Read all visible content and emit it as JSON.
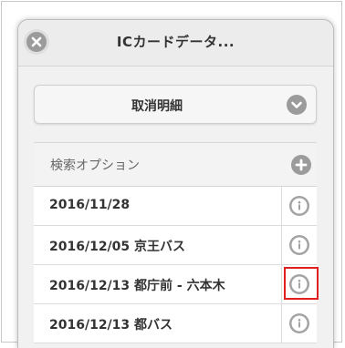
{
  "dialog": {
    "title": "ICカードデータ...",
    "close_icon": "close-icon"
  },
  "select": {
    "label": "取消明細",
    "icon": "chevron-down-icon"
  },
  "search_option": {
    "label": "検索オプション",
    "icon": "plus-icon"
  },
  "items": [
    {
      "label": "2016/11/28",
      "icon": "info-icon",
      "highlighted": false
    },
    {
      "label": "2016/12/05 京王バス",
      "icon": "info-icon",
      "highlighted": false
    },
    {
      "label": "2016/12/13 都庁前 - 六本木",
      "icon": "info-icon",
      "highlighted": true
    },
    {
      "label": "2016/12/13 都バス",
      "icon": "info-icon",
      "highlighted": false
    }
  ],
  "colors": {
    "highlight_border": "#e02020",
    "icon_gray": "#9b9b9b"
  }
}
